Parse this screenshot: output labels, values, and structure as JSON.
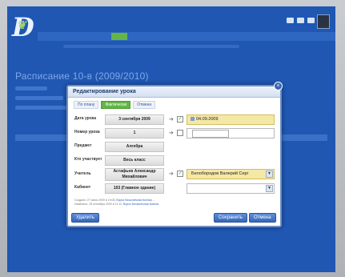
{
  "header": {
    "user_text": "",
    "active_menu": ""
  },
  "page": {
    "breadcrumb": "",
    "title": "Расписание 10-в (2009/2010)"
  },
  "modal": {
    "title": "Редактирование урока",
    "tabs": [
      {
        "label": "По плану",
        "active": false
      },
      {
        "label": "Фактически",
        "active": true
      },
      {
        "label": "Отмена",
        "active": false
      }
    ],
    "fields": {
      "date": {
        "label": "Дата урока",
        "value": "3 сентября 2009",
        "right_value": "04.09.2009"
      },
      "number": {
        "label": "Номер урока",
        "value": "1"
      },
      "subject": {
        "label": "Предмет",
        "value": "Алгебра"
      },
      "group": {
        "label": "Кто участвует",
        "value": "Весь класс"
      },
      "teacher": {
        "label": "Учитель",
        "value_line1": "Астафьев Александр",
        "value_line2": "Михайлович",
        "right_value": "Белобородов Валерий Серг"
      },
      "room": {
        "label": "Кабинет",
        "value": "103 (Главное здание)"
      }
    },
    "meta": {
      "created": "Создано: 27 июля 2009 в 19:08,",
      "created_by": "Ворох Бесконечная Ксения ...",
      "modified": "Изменено: 25 сентября 2009 в 11:12,",
      "modified_by": "Ворох Бесконечная Ксения"
    },
    "buttons": {
      "delete": "Удалить",
      "save": "Сохранить",
      "cancel": "Отмена"
    }
  },
  "colors": {
    "app_background": "#1f57b3",
    "accent_green": "#63b546",
    "highlight_yellow": "#f5e8a6"
  }
}
